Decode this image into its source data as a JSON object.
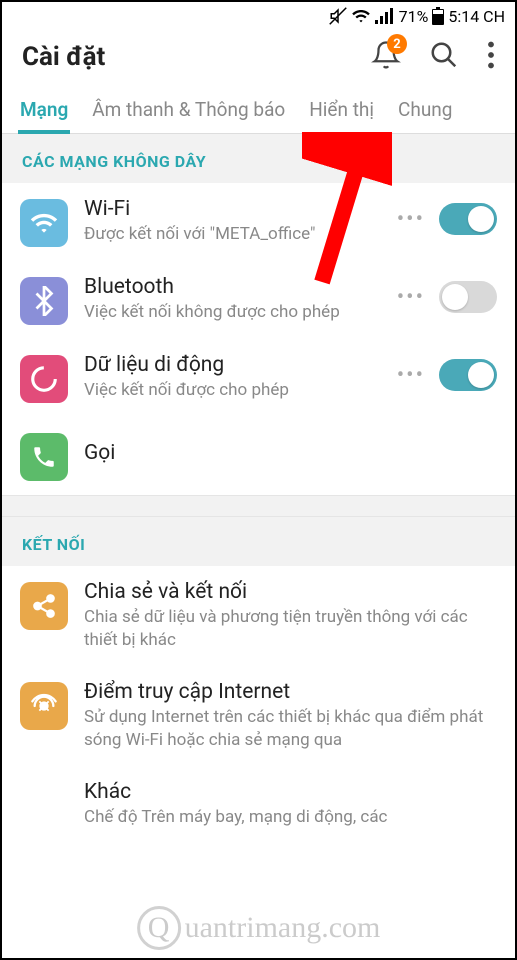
{
  "status": {
    "battery_pct": "71%",
    "time": "5:14 CH"
  },
  "header": {
    "title": "Cài đặt",
    "badge": "2"
  },
  "tabs": [
    {
      "label": "Mạng",
      "active": true
    },
    {
      "label": "Âm thanh & Thông báo",
      "active": false
    },
    {
      "label": "Hiển thị",
      "active": false
    },
    {
      "label": "Chung",
      "active": false
    }
  ],
  "sections": {
    "wireless_header": "CÁC MẠNG KHÔNG DÂY",
    "connect_header": "KẾT NỐI"
  },
  "items": {
    "wifi": {
      "title": "Wi-Fi",
      "sub": "Được kết nối với \"META_office\""
    },
    "bluetooth": {
      "title": "Bluetooth",
      "sub": "Việc kết nối không được cho phép"
    },
    "mobile_data": {
      "title": "Dữ liệu di động",
      "sub": "Việc kết nối được cho phép"
    },
    "call": {
      "title": "Gọi"
    },
    "share": {
      "title": "Chia sẻ và kết nối",
      "sub": "Chia sẻ dữ liệu và phương tiện truyền thông với các thiết bị khác"
    },
    "hotspot": {
      "title": "Điểm truy cập Internet",
      "sub": "Sử dụng Internet trên các thiết bị khác qua điểm phát sóng Wi-Fi hoặc chia sẻ mạng qua"
    },
    "other": {
      "title": "Khác",
      "sub": "Chế độ Trên máy bay, mạng di động, các"
    }
  },
  "watermark": "uantrimang.com"
}
